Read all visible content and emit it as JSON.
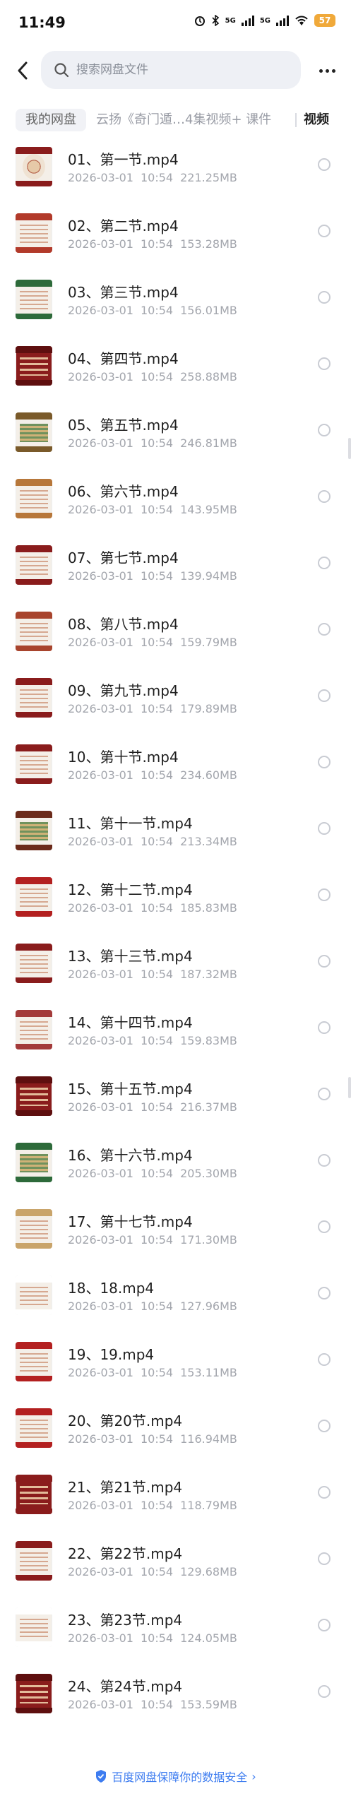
{
  "status": {
    "time": "11:49",
    "battery": "57",
    "net1": "5G",
    "net2": "5G"
  },
  "header": {
    "search_placeholder": "搜索网盘文件"
  },
  "breadcrumb": {
    "root": "我的网盘",
    "middle": "云扬《奇门遁…4集视频+ 课件",
    "current": "视频"
  },
  "files": [
    {
      "name": "01、第一节.mp4",
      "date": "2026-03-01",
      "time": "10:54",
      "size": "221.25MB",
      "thumb": "t-dial",
      "band": "#8a1c1c"
    },
    {
      "name": "02、第二节.mp4",
      "date": "2026-03-01",
      "time": "10:54",
      "size": "153.28MB",
      "thumb": "t-paper",
      "band": "#b23a2a"
    },
    {
      "name": "03、第三节.mp4",
      "date": "2026-03-01",
      "time": "10:54",
      "size": "156.01MB",
      "thumb": "t-paper",
      "band": "#2d6a3a"
    },
    {
      "name": "04、第四节.mp4",
      "date": "2026-03-01",
      "time": "10:54",
      "size": "258.88MB",
      "thumb": "t-red",
      "band": "#5e0f0f"
    },
    {
      "name": "05、第五节.mp4",
      "date": "2026-03-01",
      "time": "10:54",
      "size": "246.81MB",
      "thumb": "t-green",
      "band": "#7a5a2a"
    },
    {
      "name": "06、第六节.mp4",
      "date": "2026-03-01",
      "time": "10:54",
      "size": "143.95MB",
      "thumb": "t-paper",
      "band": "#b7773a"
    },
    {
      "name": "07、第七节.mp4",
      "date": "2026-03-01",
      "time": "10:54",
      "size": "139.94MB",
      "thumb": "t-paper",
      "band": "#8a1c1c"
    },
    {
      "name": "08、第八节.mp4",
      "date": "2026-03-01",
      "time": "10:54",
      "size": "159.79MB",
      "thumb": "t-paper",
      "band": "#a8442d"
    },
    {
      "name": "09、第九节.mp4",
      "date": "2026-03-01",
      "time": "10:54",
      "size": "179.89MB",
      "thumb": "t-paper",
      "band": "#8a1c1c"
    },
    {
      "name": "10、第十节.mp4",
      "date": "2026-03-01",
      "time": "10:54",
      "size": "234.60MB",
      "thumb": "t-paper",
      "band": "#8a1c1c"
    },
    {
      "name": "11、第十一节.mp4",
      "date": "2026-03-01",
      "time": "10:54",
      "size": "213.34MB",
      "thumb": "t-green",
      "band": "#6b2a1a"
    },
    {
      "name": "12、第十二节.mp4",
      "date": "2026-03-01",
      "time": "10:54",
      "size": "185.83MB",
      "thumb": "t-paper",
      "band": "#b32020"
    },
    {
      "name": "13、第十三节.mp4",
      "date": "2026-03-01",
      "time": "10:54",
      "size": "187.32MB",
      "thumb": "t-paper",
      "band": "#8a1c1c"
    },
    {
      "name": "14、第十四节.mp4",
      "date": "2026-03-01",
      "time": "10:54",
      "size": "159.83MB",
      "thumb": "t-paper",
      "band": "#a33a3a"
    },
    {
      "name": "15、第十五节.mp4",
      "date": "2026-03-01",
      "time": "10:54",
      "size": "216.37MB",
      "thumb": "t-red",
      "band": "#5e0f0f"
    },
    {
      "name": "16、第十六节.mp4",
      "date": "2026-03-01",
      "time": "10:54",
      "size": "205.30MB",
      "thumb": "t-green",
      "band": "#2d6a3a"
    },
    {
      "name": "17、第十七节.mp4",
      "date": "2026-03-01",
      "time": "10:54",
      "size": "171.30MB",
      "thumb": "t-paper",
      "band": "#c9a46a"
    },
    {
      "name": "18、18.mp4",
      "date": "2026-03-01",
      "time": "10:54",
      "size": "127.96MB",
      "thumb": "t-paper",
      "band": "#ffffff"
    },
    {
      "name": "19、19.mp4",
      "date": "2026-03-01",
      "time": "10:54",
      "size": "153.11MB",
      "thumb": "t-paper",
      "band": "#b32020"
    },
    {
      "name": "20、第20节.mp4",
      "date": "2026-03-01",
      "time": "10:54",
      "size": "116.94MB",
      "thumb": "t-paper",
      "band": "#b32020"
    },
    {
      "name": "21、第21节.mp4",
      "date": "2026-03-01",
      "time": "10:54",
      "size": "118.79MB",
      "thumb": "t-red",
      "band": "#8a1c1c"
    },
    {
      "name": "22、第22节.mp4",
      "date": "2026-03-01",
      "time": "10:54",
      "size": "129.68MB",
      "thumb": "t-paper",
      "band": "#8a1c1c"
    },
    {
      "name": "23、第23节.mp4",
      "date": "2026-03-01",
      "time": "10:54",
      "size": "124.05MB",
      "thumb": "t-paper",
      "band": "#ffffff"
    },
    {
      "name": "24、第24节.mp4",
      "date": "2026-03-01",
      "time": "10:54",
      "size": "153.59MB",
      "thumb": "t-red",
      "band": "#5e0f0f"
    }
  ],
  "footer": {
    "text": "百度网盘保障你的数据安全"
  },
  "colors": {
    "accent": "#3d7cf0",
    "meta": "#a3a6ad"
  }
}
